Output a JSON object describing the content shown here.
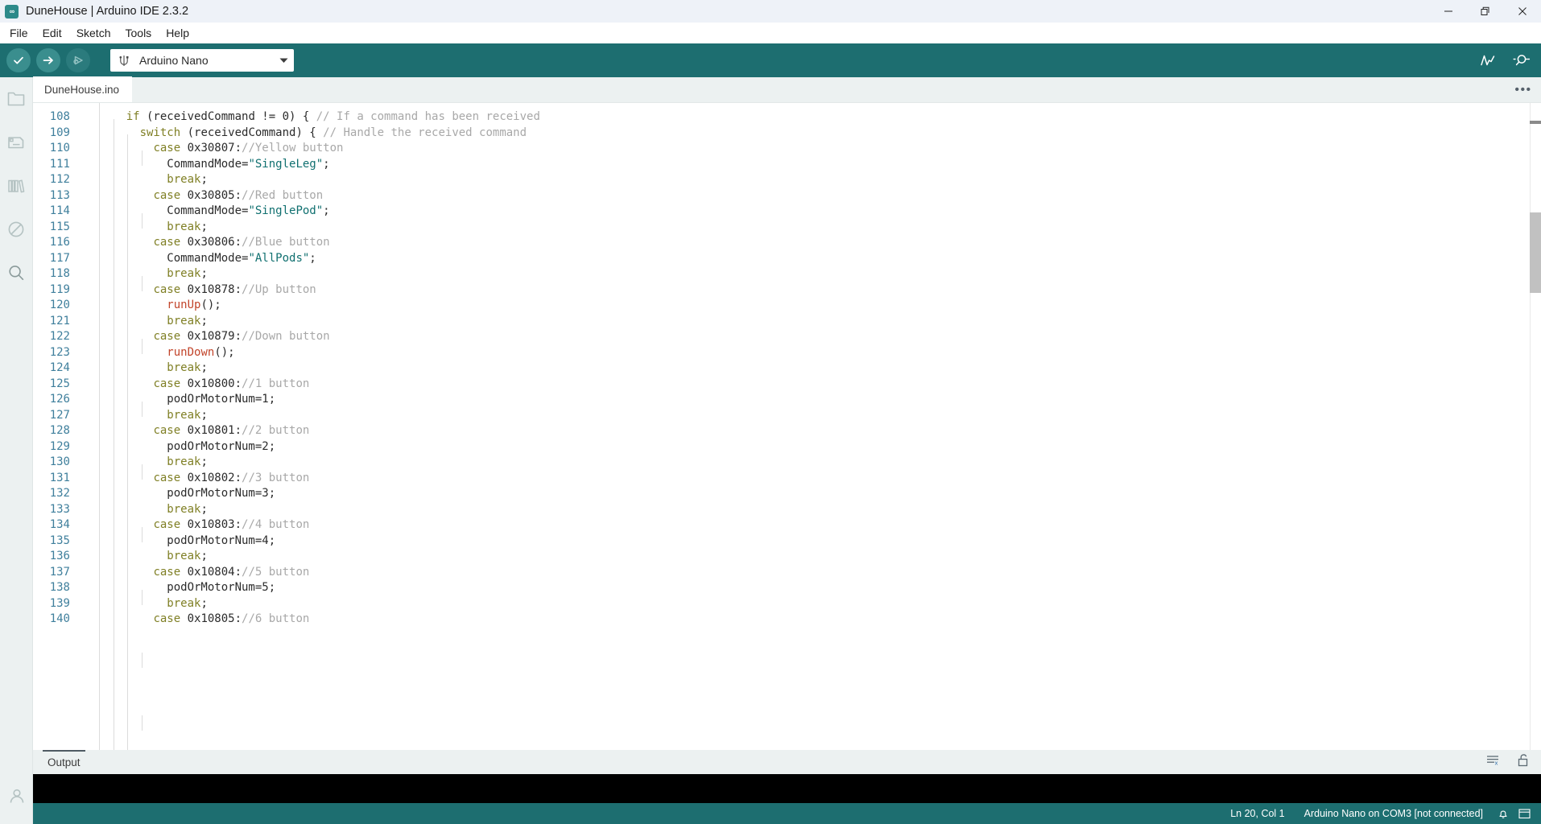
{
  "window": {
    "title": "DuneHouse | Arduino IDE 2.3.2",
    "logo_glyph": "∞",
    "minimize_glyph": "—",
    "restore_glyph": "❐",
    "close_glyph": "✕"
  },
  "menubar": {
    "items": [
      {
        "label": "File"
      },
      {
        "label": "Edit"
      },
      {
        "label": "Sketch"
      },
      {
        "label": "Tools"
      },
      {
        "label": "Help"
      }
    ]
  },
  "toolbar": {
    "verify_label": "Verify",
    "upload_label": "Upload",
    "debug_label": "Debug",
    "board_value": "Arduino Nano",
    "caret_glyph": "▼",
    "serial_plotter_label": "Serial Plotter",
    "serial_monitor_label": "Serial Monitor",
    "accent_bg": "#1d6e70"
  },
  "activitybar": {
    "items": [
      {
        "name": "sketchbook",
        "label": "Sketchbook"
      },
      {
        "name": "boards-manager",
        "label": "Boards Manager"
      },
      {
        "name": "library-manager",
        "label": "Library Manager"
      },
      {
        "name": "debug",
        "label": "Debug"
      },
      {
        "name": "search",
        "label": "Search"
      }
    ],
    "account_label": "Account"
  },
  "tabbar": {
    "tabs": [
      {
        "label": "DuneHouse.ino",
        "active": true
      }
    ],
    "overflow_glyph": "•••"
  },
  "editor": {
    "first_line_number": 108,
    "lines": [
      {
        "n": 108,
        "tokens": [
          {
            "t": "    ",
            "c": "plain"
          },
          {
            "t": "if",
            "c": "kw"
          },
          {
            "t": " (receivedCommand != ",
            "c": "plain"
          },
          {
            "t": "0",
            "c": "num"
          },
          {
            "t": ") { ",
            "c": "plain"
          },
          {
            "t": "// If a command has been received",
            "c": "cmt"
          }
        ]
      },
      {
        "n": 109,
        "tokens": [
          {
            "t": "      ",
            "c": "plain"
          },
          {
            "t": "switch",
            "c": "kw"
          },
          {
            "t": " (receivedCommand) { ",
            "c": "plain"
          },
          {
            "t": "// Handle the received command",
            "c": "cmt"
          }
        ]
      },
      {
        "n": 110,
        "tokens": [
          {
            "t": "        ",
            "c": "plain"
          },
          {
            "t": "case",
            "c": "kw"
          },
          {
            "t": " 0x30807:",
            "c": "plain"
          },
          {
            "t": "//Yellow button",
            "c": "cmt"
          }
        ]
      },
      {
        "n": 111,
        "tokens": [
          {
            "t": "          CommandMode=",
            "c": "plain"
          },
          {
            "t": "\"SingleLeg\"",
            "c": "str"
          },
          {
            "t": ";",
            "c": "plain"
          }
        ]
      },
      {
        "n": 112,
        "tokens": [
          {
            "t": "          ",
            "c": "plain"
          },
          {
            "t": "break",
            "c": "kw"
          },
          {
            "t": ";",
            "c": "plain"
          }
        ]
      },
      {
        "n": 113,
        "tokens": [
          {
            "t": "        ",
            "c": "plain"
          },
          {
            "t": "case",
            "c": "kw"
          },
          {
            "t": " 0x30805:",
            "c": "plain"
          },
          {
            "t": "//Red button",
            "c": "cmt"
          }
        ]
      },
      {
        "n": 114,
        "tokens": [
          {
            "t": "          CommandMode=",
            "c": "plain"
          },
          {
            "t": "\"SinglePod\"",
            "c": "str"
          },
          {
            "t": ";",
            "c": "plain"
          }
        ]
      },
      {
        "n": 115,
        "tokens": [
          {
            "t": "          ",
            "c": "plain"
          },
          {
            "t": "break",
            "c": "kw"
          },
          {
            "t": ";",
            "c": "plain"
          }
        ]
      },
      {
        "n": 116,
        "tokens": [
          {
            "t": "        ",
            "c": "plain"
          },
          {
            "t": "case",
            "c": "kw"
          },
          {
            "t": " 0x30806:",
            "c": "plain"
          },
          {
            "t": "//Blue button",
            "c": "cmt"
          }
        ]
      },
      {
        "n": 117,
        "tokens": [
          {
            "t": "          CommandMode=",
            "c": "plain"
          },
          {
            "t": "\"AllPods\"",
            "c": "str"
          },
          {
            "t": ";",
            "c": "plain"
          }
        ]
      },
      {
        "n": 118,
        "tokens": [
          {
            "t": "          ",
            "c": "plain"
          },
          {
            "t": "break",
            "c": "kw"
          },
          {
            "t": ";",
            "c": "plain"
          }
        ]
      },
      {
        "n": 119,
        "tokens": [
          {
            "t": "        ",
            "c": "plain"
          },
          {
            "t": "case",
            "c": "kw"
          },
          {
            "t": " 0x10878:",
            "c": "plain"
          },
          {
            "t": "//Up button",
            "c": "cmt"
          }
        ]
      },
      {
        "n": 120,
        "tokens": [
          {
            "t": "          ",
            "c": "plain"
          },
          {
            "t": "runUp",
            "c": "fn"
          },
          {
            "t": "();",
            "c": "plain"
          }
        ]
      },
      {
        "n": 121,
        "tokens": [
          {
            "t": "          ",
            "c": "plain"
          },
          {
            "t": "break",
            "c": "kw"
          },
          {
            "t": ";",
            "c": "plain"
          }
        ]
      },
      {
        "n": 122,
        "tokens": [
          {
            "t": "        ",
            "c": "plain"
          },
          {
            "t": "case",
            "c": "kw"
          },
          {
            "t": " 0x10879:",
            "c": "plain"
          },
          {
            "t": "//Down button",
            "c": "cmt"
          }
        ]
      },
      {
        "n": 123,
        "tokens": [
          {
            "t": "          ",
            "c": "plain"
          },
          {
            "t": "runDown",
            "c": "fn"
          },
          {
            "t": "();",
            "c": "plain"
          }
        ]
      },
      {
        "n": 124,
        "tokens": [
          {
            "t": "          ",
            "c": "plain"
          },
          {
            "t": "break",
            "c": "kw"
          },
          {
            "t": ";",
            "c": "plain"
          }
        ]
      },
      {
        "n": 125,
        "tokens": [
          {
            "t": "        ",
            "c": "plain"
          },
          {
            "t": "case",
            "c": "kw"
          },
          {
            "t": " 0x10800:",
            "c": "plain"
          },
          {
            "t": "//1 button",
            "c": "cmt"
          }
        ]
      },
      {
        "n": 126,
        "tokens": [
          {
            "t": "          podOrMotorNum=",
            "c": "plain"
          },
          {
            "t": "1",
            "c": "num"
          },
          {
            "t": ";",
            "c": "plain"
          }
        ]
      },
      {
        "n": 127,
        "tokens": [
          {
            "t": "          ",
            "c": "plain"
          },
          {
            "t": "break",
            "c": "kw"
          },
          {
            "t": ";",
            "c": "plain"
          }
        ]
      },
      {
        "n": 128,
        "tokens": [
          {
            "t": "        ",
            "c": "plain"
          },
          {
            "t": "case",
            "c": "kw"
          },
          {
            "t": " 0x10801:",
            "c": "plain"
          },
          {
            "t": "//2 button",
            "c": "cmt"
          }
        ]
      },
      {
        "n": 129,
        "tokens": [
          {
            "t": "          podOrMotorNum=",
            "c": "plain"
          },
          {
            "t": "2",
            "c": "num"
          },
          {
            "t": ";",
            "c": "plain"
          }
        ]
      },
      {
        "n": 130,
        "tokens": [
          {
            "t": "          ",
            "c": "plain"
          },
          {
            "t": "break",
            "c": "kw"
          },
          {
            "t": ";",
            "c": "plain"
          }
        ]
      },
      {
        "n": 131,
        "tokens": [
          {
            "t": "        ",
            "c": "plain"
          },
          {
            "t": "case",
            "c": "kw"
          },
          {
            "t": " 0x10802:",
            "c": "plain"
          },
          {
            "t": "//3 button",
            "c": "cmt"
          }
        ]
      },
      {
        "n": 132,
        "tokens": [
          {
            "t": "          podOrMotorNum=",
            "c": "plain"
          },
          {
            "t": "3",
            "c": "num"
          },
          {
            "t": ";",
            "c": "plain"
          }
        ]
      },
      {
        "n": 133,
        "tokens": [
          {
            "t": "          ",
            "c": "plain"
          },
          {
            "t": "break",
            "c": "kw"
          },
          {
            "t": ";",
            "c": "plain"
          }
        ]
      },
      {
        "n": 134,
        "tokens": [
          {
            "t": "        ",
            "c": "plain"
          },
          {
            "t": "case",
            "c": "kw"
          },
          {
            "t": " 0x10803:",
            "c": "plain"
          },
          {
            "t": "//4 button",
            "c": "cmt"
          }
        ]
      },
      {
        "n": 135,
        "tokens": [
          {
            "t": "          podOrMotorNum=",
            "c": "plain"
          },
          {
            "t": "4",
            "c": "num"
          },
          {
            "t": ";",
            "c": "plain"
          }
        ]
      },
      {
        "n": 136,
        "tokens": [
          {
            "t": "          ",
            "c": "plain"
          },
          {
            "t": "break",
            "c": "kw"
          },
          {
            "t": ";",
            "c": "plain"
          }
        ]
      },
      {
        "n": 137,
        "tokens": [
          {
            "t": "        ",
            "c": "plain"
          },
          {
            "t": "case",
            "c": "kw"
          },
          {
            "t": " 0x10804:",
            "c": "plain"
          },
          {
            "t": "//5 button",
            "c": "cmt"
          }
        ]
      },
      {
        "n": 138,
        "tokens": [
          {
            "t": "          podOrMotorNum=",
            "c": "plain"
          },
          {
            "t": "5",
            "c": "num"
          },
          {
            "t": ";",
            "c": "plain"
          }
        ]
      },
      {
        "n": 139,
        "tokens": [
          {
            "t": "          ",
            "c": "plain"
          },
          {
            "t": "break",
            "c": "kw"
          },
          {
            "t": ";",
            "c": "plain"
          }
        ]
      },
      {
        "n": 140,
        "tokens": [
          {
            "t": "        ",
            "c": "plain"
          },
          {
            "t": "case",
            "c": "kw"
          },
          {
            "t": " 0x10805:",
            "c": "plain"
          },
          {
            "t": "//6 button",
            "c": "cmt"
          }
        ]
      }
    ]
  },
  "panel": {
    "tab_label": "Output",
    "clear_label": "Clear Output",
    "lock_label": "Toggle Auto Scroll",
    "console_text": ""
  },
  "statusbar": {
    "cursor_position": "Ln 20, Col 1",
    "board_status": "Arduino Nano on COM3 [not connected]",
    "notification_label": "Notifications",
    "panel_toggle_label": "Toggle Bottom Panel"
  },
  "colors": {
    "accent": "#1d6e70",
    "titlebar_bg": "#eef2f8",
    "sidebar_bg": "#ecf1f1",
    "editor_bg": "#ffffff",
    "console_bg": "#000000",
    "linenum": "#3f7f9c",
    "keyword": "#7f7f24",
    "string": "#107070",
    "comment": "#a8a8a8",
    "function": "#c2452b"
  }
}
